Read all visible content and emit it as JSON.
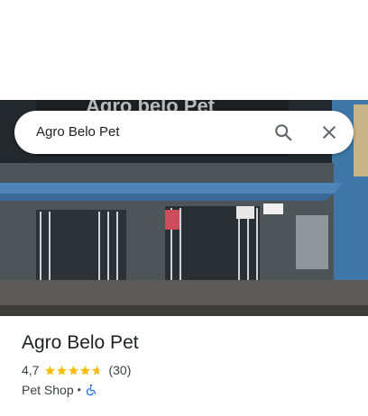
{
  "search": {
    "query": "Agro Belo Pet",
    "search_icon": "search-icon",
    "close_icon": "close-icon"
  },
  "photo": {
    "sign_text": "Agro belo Pet"
  },
  "place": {
    "name": "Agro Belo Pet",
    "rating": "4,7",
    "rating_value": 4.7,
    "review_count": "(30)",
    "category": "Pet Shop",
    "separator": "•",
    "accessibility_icon": "wheelchair-icon"
  },
  "colors": {
    "star": "#fbbc04",
    "star_empty": "#dadce0",
    "accent": "#1a73e8",
    "text": "#202124",
    "secondary": "#3c4043"
  }
}
